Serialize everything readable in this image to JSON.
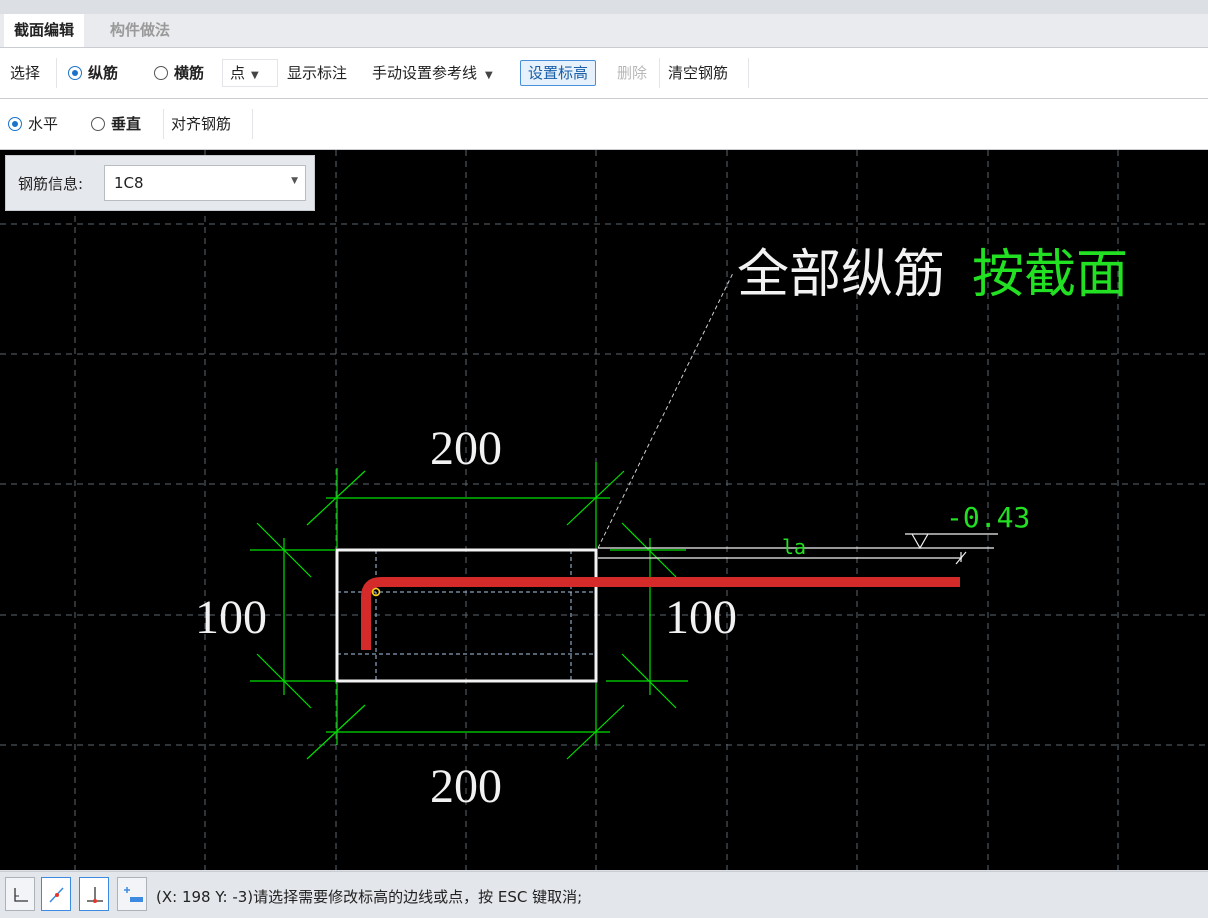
{
  "tabs": [
    {
      "label": "截面编辑",
      "active": true
    },
    {
      "label": "构件做法",
      "active": false
    }
  ],
  "toolbar1": {
    "select_label": "选择",
    "longitudinal_label": "纵筋",
    "transverse_label": "横筋",
    "point_select_value": "点",
    "show_annotation_label": "显示标注",
    "manual_reference_label": "手动设置参考线",
    "set_elevation_label": "设置标高",
    "delete_label": "删除",
    "clear_rebar_label": "清空钢筋",
    "mode_selected": "纵筋"
  },
  "toolbar2": {
    "horizontal_label": "水平",
    "vertical_label": "垂直",
    "align_rebar_label": "对齐钢筋",
    "orientation_selected": "水平"
  },
  "rebar_info": {
    "label": "钢筋信息:",
    "value": "1C8"
  },
  "drawing": {
    "callout_white": "全部纵筋",
    "callout_green": "按截面",
    "dim_top": "200",
    "dim_bottom": "200",
    "dim_left": "100",
    "dim_right": "100",
    "anchor_label": "la",
    "elevation_label": "-0.43"
  },
  "colors": {
    "canvas_bg": "#000000",
    "dimension": "#00e000",
    "rebar": "#d42a2a",
    "outline": "#ffffff",
    "accent": "#1a73c9"
  },
  "status": {
    "message": "(X: 198 Y: -3)请选择需要修改标高的边线或点，按 ESC 键取消;"
  },
  "status_icons": [
    "ortho-mode-icon",
    "snap-line-icon",
    "perpendicular-icon",
    "elevation-add-icon"
  ]
}
